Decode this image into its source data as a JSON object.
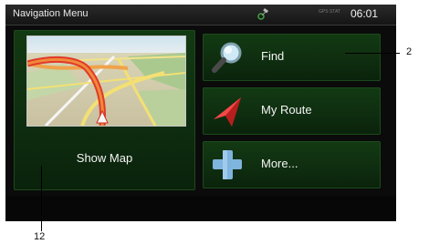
{
  "status_bar": {
    "title": "Navigation Menu",
    "gps_icon": "gps-satellite-icon",
    "mini_status": "GPS STAT",
    "time": "06:01"
  },
  "map_tile": {
    "label": "Show Map"
  },
  "menu_buttons": [
    {
      "label": "Find",
      "icon": "magnifier-icon"
    },
    {
      "label": "My Route",
      "icon": "route-arrow-icon"
    },
    {
      "label": "More...",
      "icon": "plus-icon"
    }
  ],
  "callouts": {
    "right": "2",
    "bottom": "12"
  },
  "colors": {
    "tile_green": "#123a12",
    "screen_bg": "#0b0b0b",
    "route_red": "#e33030"
  }
}
